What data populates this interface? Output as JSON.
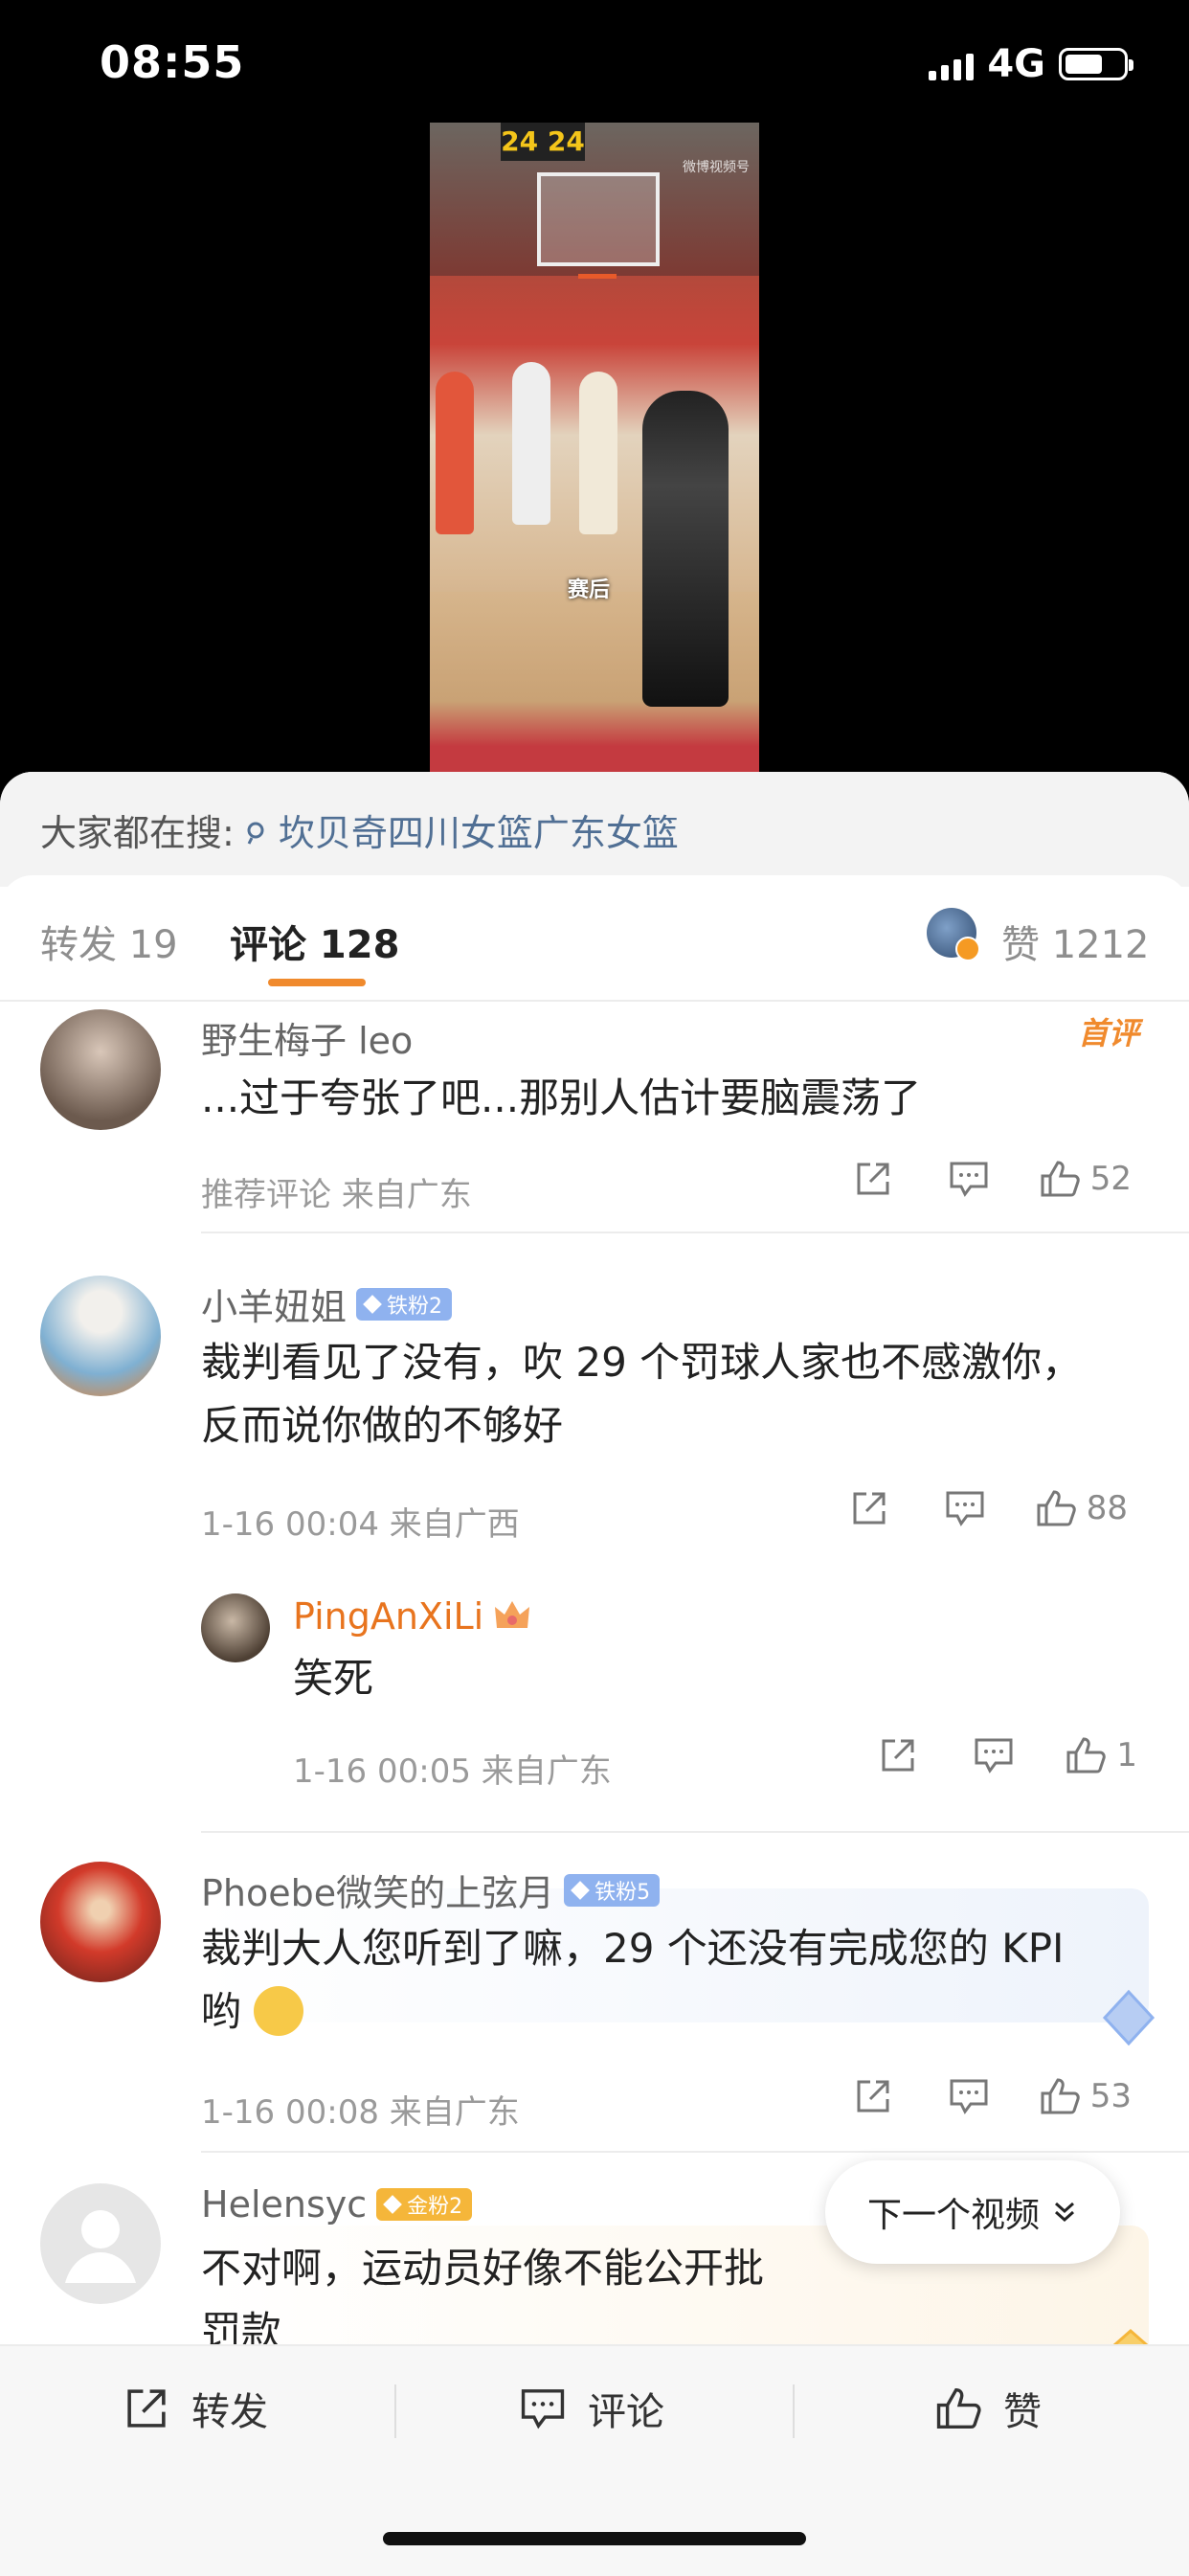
{
  "status_bar": {
    "time": "08:55",
    "network": "4G"
  },
  "video": {
    "caption": "赛后",
    "scoreboard": "24 24",
    "watermark": "微博视频号"
  },
  "search": {
    "label": "大家都在搜:",
    "query": "坎贝奇四川女篮广东女篮"
  },
  "tabs": {
    "repost": "转发 19",
    "comments": "评论 128",
    "likes": "赞 1212"
  },
  "comments": [
    {
      "name": "野生梅子 leo",
      "tag": "首评",
      "text": "...过于夸张了吧...那别人估计要脑震荡了",
      "meta": "推荐评论  来自广东",
      "likes": "52"
    },
    {
      "name": "小羊妞姐",
      "badge": "铁粉2",
      "text_line1": "裁判看见了没有，吹 29 个罚球人家也不感激你，",
      "text_line2": "反而说你做的不够好",
      "meta": "1-16 00:04  来自广西",
      "likes": "88"
    },
    {
      "name": "PingAnXiLi",
      "text": "笑死",
      "meta": "1-16 00:05  来自广东",
      "likes": "1"
    },
    {
      "name": "Phoebe微笑的上弦月",
      "badge": "铁粉5",
      "text_line1": "裁判大人您听到了嘛，29 个还没有完成您的 KPI",
      "text_line2": "哟",
      "meta": "1-16 00:08  来自广东",
      "likes": "53"
    },
    {
      "name": "Helensyc",
      "badge": "金粉2",
      "text_line1": "不对啊，运动员好像不能公开批",
      "text_line2": "罚款"
    }
  ],
  "next_video": "下一个视频",
  "bottom_bar": {
    "repost": "转发",
    "comment": "评论",
    "like": "赞"
  },
  "colors": {
    "accent": "#f08a2d",
    "link": "#506f94",
    "iron_badge": "#8fb2ef",
    "gold_badge": "#f5b63a"
  }
}
